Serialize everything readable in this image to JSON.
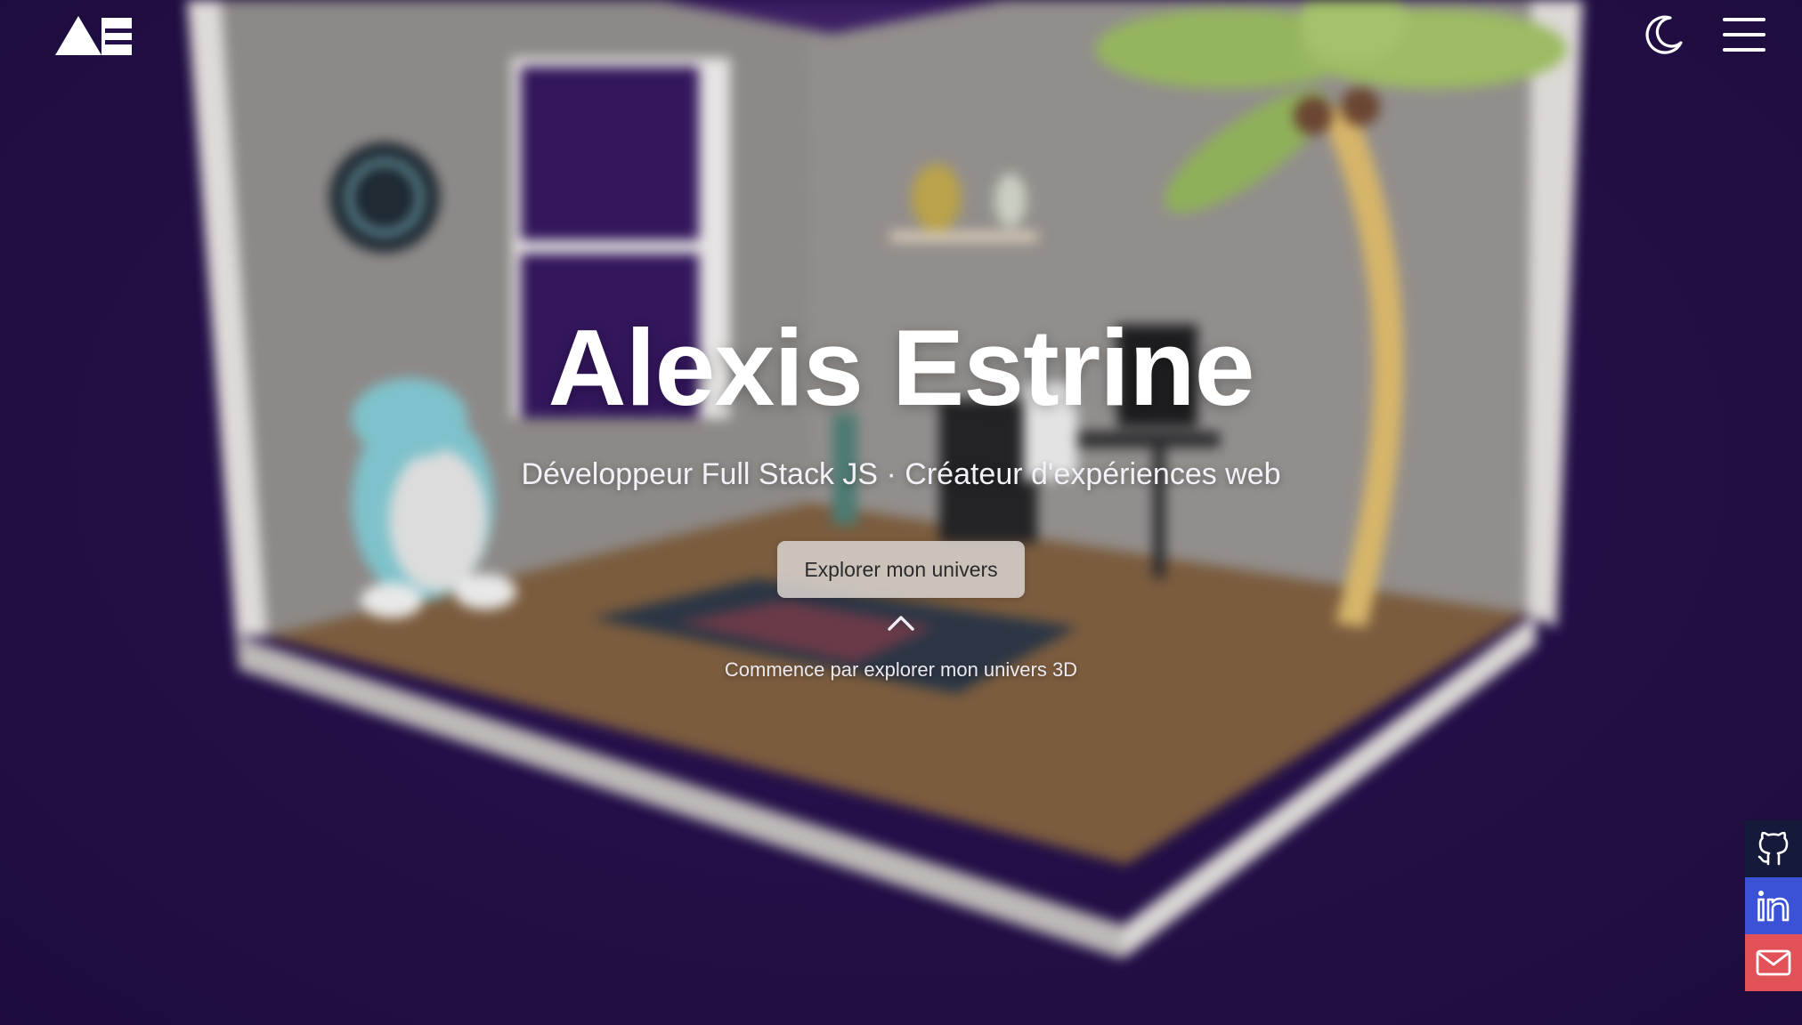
{
  "header": {
    "logo_alt": "AE",
    "theme_toggle_icon": "moon-icon",
    "menu_icon": "hamburger-menu-icon"
  },
  "hero": {
    "title": "Alexis Estrine",
    "subtitle": "Développeur Full Stack JS · Créateur d'expériences web",
    "cta_label": "Explorer mon univers",
    "scroll_icon": "chevron-up-icon",
    "scroll_hint": "Commence par explorer mon univers 3D"
  },
  "social": {
    "items": [
      {
        "icon": "github-icon",
        "color": "#151a3b"
      },
      {
        "icon": "linkedin-icon",
        "color": "#3c52d6"
      },
      {
        "icon": "mail-icon",
        "color": "#e05257"
      }
    ]
  },
  "colors": {
    "background": "#241049",
    "wall": "#8f8b89",
    "floor": "#7a5b3c"
  }
}
